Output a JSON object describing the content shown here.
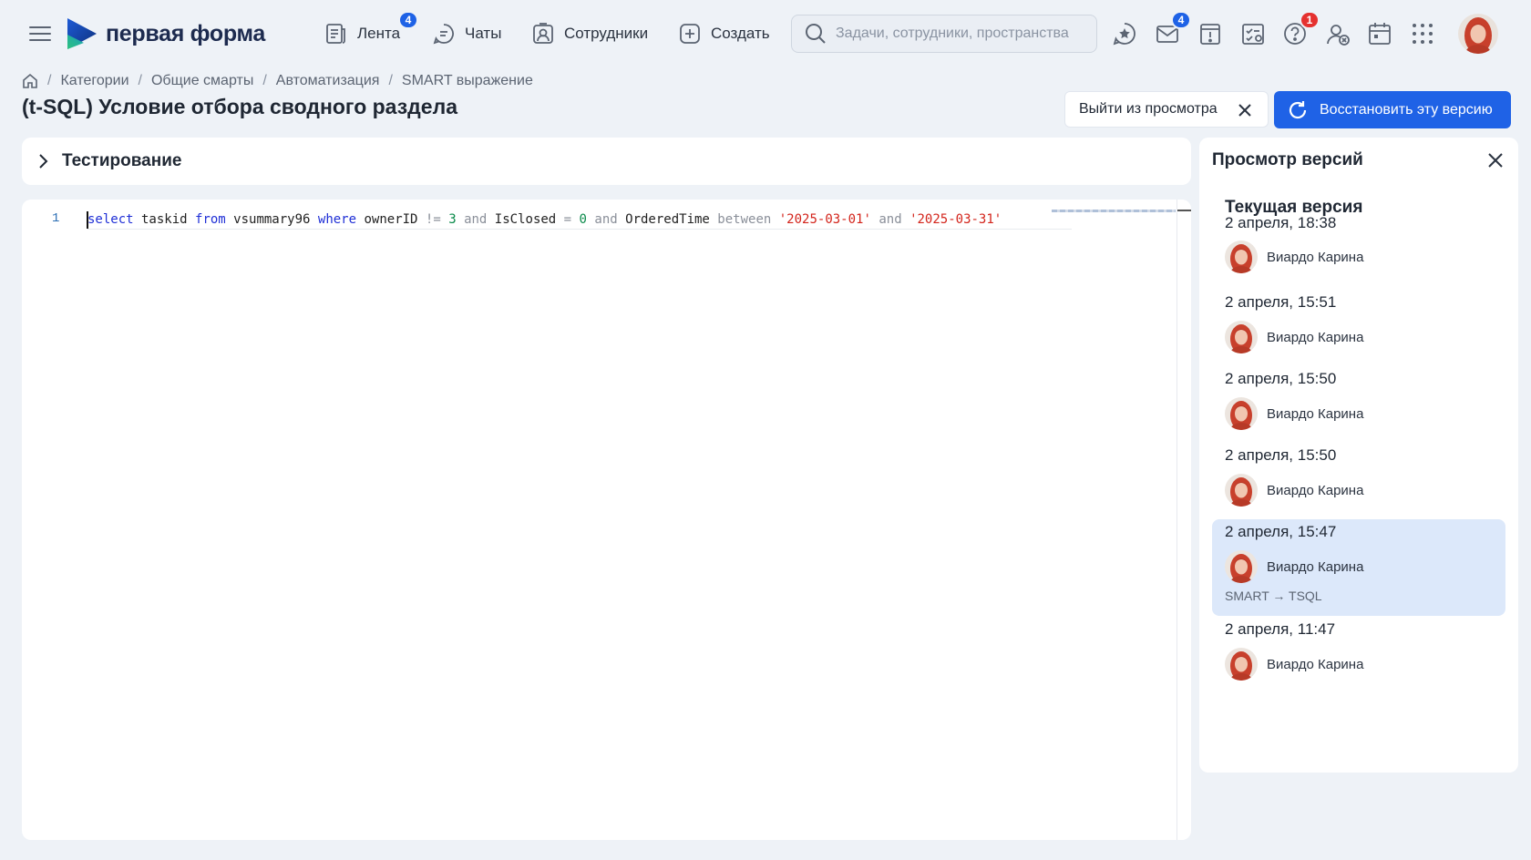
{
  "app": {
    "logo_text": "первая форма",
    "brand_color": "#1d2b4f",
    "accent": "#1f62e6"
  },
  "nav": {
    "feed_label": "Лента",
    "feed_badge": "4",
    "chats_label": "Чаты",
    "employees_label": "Сотрудники",
    "create_label": "Создать"
  },
  "search": {
    "placeholder": "Задачи, сотрудники, пространства"
  },
  "toolbar": {
    "icons": [
      "favorites-icon",
      "mail-icon",
      "alert-icon",
      "tasks-icon",
      "help-icon",
      "contacts-icon",
      "calendar-icon",
      "apps-grid-icon"
    ],
    "mail_badge": "4",
    "help_badge": "1"
  },
  "breadcrumb": {
    "items": [
      "Категории",
      "Общие смарты",
      "Автоматизация",
      "SMART выражение"
    ]
  },
  "page": {
    "title": "(t-SQL) Условие отбора сводного раздела",
    "exit_label": "Выйти из просмотра",
    "restore_label": "Восстановить эту версию"
  },
  "testing": {
    "title": "Тестирование"
  },
  "editor": {
    "line_number": "1",
    "tokens": [
      {
        "t": "select",
        "c": "kw"
      },
      {
        "t": " taskid ",
        "c": ""
      },
      {
        "t": "from",
        "c": "kw"
      },
      {
        "t": " vsummary96 ",
        "c": ""
      },
      {
        "t": "where",
        "c": "kw"
      },
      {
        "t": " ownerID ",
        "c": ""
      },
      {
        "t": "!=",
        "c": "op"
      },
      {
        "t": " ",
        "c": ""
      },
      {
        "t": "3",
        "c": "num"
      },
      {
        "t": " ",
        "c": ""
      },
      {
        "t": "and",
        "c": "op"
      },
      {
        "t": " IsClosed ",
        "c": ""
      },
      {
        "t": "=",
        "c": "op"
      },
      {
        "t": " ",
        "c": ""
      },
      {
        "t": "0",
        "c": "num"
      },
      {
        "t": " ",
        "c": ""
      },
      {
        "t": "and",
        "c": "op"
      },
      {
        "t": " OrderedTime ",
        "c": ""
      },
      {
        "t": "between",
        "c": "op"
      },
      {
        "t": " ",
        "c": ""
      },
      {
        "t": "'2025-03-01'",
        "c": "str"
      },
      {
        "t": " ",
        "c": ""
      },
      {
        "t": "and",
        "c": "op"
      },
      {
        "t": " ",
        "c": ""
      },
      {
        "t": "'2025-03-31'",
        "c": "str"
      }
    ]
  },
  "versions": {
    "title": "Просмотр версий",
    "current_label": "Текущая версия",
    "items": [
      {
        "date": "2 апреля, 18:38",
        "author": "Виардо Карина",
        "note": "",
        "selected": false
      },
      {
        "date": "2 апреля, 15:51",
        "author": "Виардо Карина",
        "note": "",
        "selected": false
      },
      {
        "date": "2 апреля, 15:50",
        "author": "Виардо Карина",
        "note": "",
        "selected": false
      },
      {
        "date": "2 апреля, 15:50",
        "author": "Виардо Карина",
        "note": "",
        "selected": false
      },
      {
        "date": "2 апреля, 15:47",
        "author": "Виардо Карина",
        "note": "SMART → TSQL",
        "selected": true
      },
      {
        "date": "2 апреля, 11:47",
        "author": "Виардо Карина",
        "note": "",
        "selected": false
      }
    ]
  }
}
